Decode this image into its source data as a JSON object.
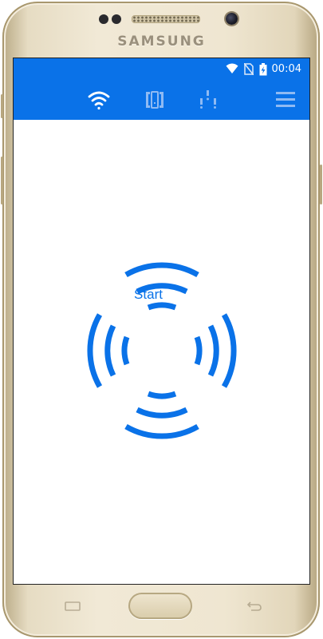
{
  "device": {
    "brand": "SAMSUNG"
  },
  "status_bar": {
    "time": "00:04",
    "icons": [
      "wifi-icon",
      "no-sim-icon",
      "battery-charging-icon"
    ]
  },
  "toolbar": {
    "tabs": [
      {
        "name": "wifi-tab",
        "icon": "wifi-icon",
        "active": true
      },
      {
        "name": "device-tab",
        "icon": "device-icon",
        "active": false
      },
      {
        "name": "network-tab",
        "icon": "network-antenna-icon",
        "active": false
      },
      {
        "name": "menu-tab",
        "icon": "menu-icon",
        "active": false
      }
    ]
  },
  "main": {
    "start_label": "Start"
  },
  "colors": {
    "accent": "#0a72e8",
    "background": "#ffffff",
    "phone_body": "#e9dfc8"
  }
}
